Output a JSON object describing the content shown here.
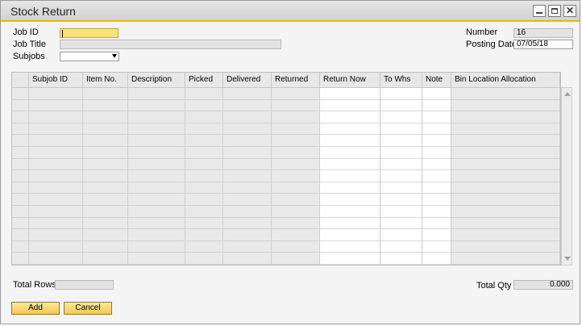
{
  "window": {
    "title": "Stock Return",
    "close_glyph": "✕"
  },
  "header": {
    "job_id_label": "Job ID",
    "job_title_label": "Job Title",
    "subjobs_label": "Subjobs",
    "job_id_value": "",
    "job_title_value": "",
    "subjobs_value": "",
    "number_label": "Number",
    "number_value": "16",
    "posting_date_label": "Posting Date",
    "posting_date_value": "07/05/18"
  },
  "grid": {
    "columns": [
      "",
      "Subjob ID",
      "Item No.",
      "Description",
      "Picked",
      "Delivered",
      "Returned",
      "Return Now",
      "To Whs",
      "Note",
      "Bin Location Allocation"
    ],
    "row_count": 15
  },
  "footer": {
    "total_rows_label": "Total Rows",
    "total_rows_value": "",
    "total_qty_label": "Total Qty",
    "total_qty_value": "0.000"
  },
  "actions": {
    "add_label": "Add",
    "cancel_label": "Cancel"
  },
  "colors": {
    "accent": "#f0b400",
    "active_field": "#f8e27a",
    "button": "#f2c94f"
  }
}
